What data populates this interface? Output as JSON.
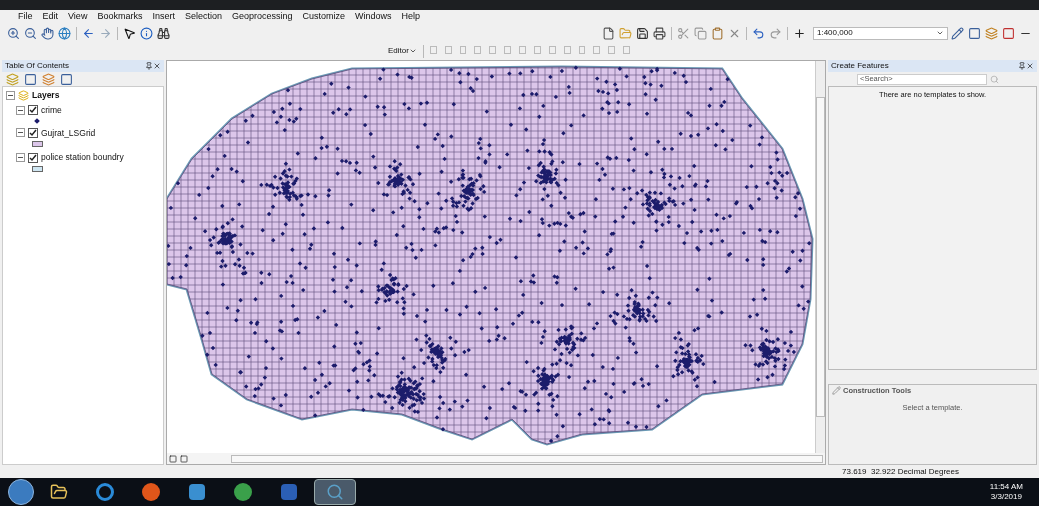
{
  "menu": [
    "File",
    "Edit",
    "View",
    "Bookmarks",
    "Insert",
    "Selection",
    "Geoprocessing",
    "Customize",
    "Windows",
    "Help"
  ],
  "toolbar": {
    "scale": "1:400,000"
  },
  "editor_toolbar": {
    "label": "Editor"
  },
  "table_of_contents": {
    "title": "Table Of Contents",
    "root": {
      "label": "Layers",
      "expanded": true,
      "children": [
        {
          "label": "crime",
          "checked": true,
          "expanded": true,
          "kind": "point",
          "color": "#1c1c6b"
        },
        {
          "label": "Gujrat_LSGrid",
          "checked": true,
          "expanded": true,
          "kind": "fill",
          "color": "#dcc6ea"
        },
        {
          "label": "police station boundry",
          "checked": true,
          "expanded": true,
          "kind": "fill",
          "color": "#cfe6f2"
        }
      ]
    }
  },
  "create_features": {
    "title": "Create Features",
    "search": {
      "placeholder": "<Search>"
    },
    "message": "There are no templates to show."
  },
  "construction_tools": {
    "title": "Construction Tools",
    "message": "Select a template."
  },
  "status_bar": {
    "coordinates": "73.619  32.922 Decimal Degrees"
  },
  "taskbar": {
    "apps": [
      {
        "kind": "explorer",
        "selected": false
      },
      {
        "kind": "browser",
        "selected": false
      },
      {
        "kind": "media",
        "selected": false
      },
      {
        "kind": "player",
        "selected": false
      },
      {
        "kind": "chrome",
        "selected": false
      },
      {
        "kind": "word",
        "selected": false
      },
      {
        "kind": "arcmap",
        "selected": true
      }
    ],
    "time": "11:54 AM",
    "date": "3/3/2019"
  }
}
